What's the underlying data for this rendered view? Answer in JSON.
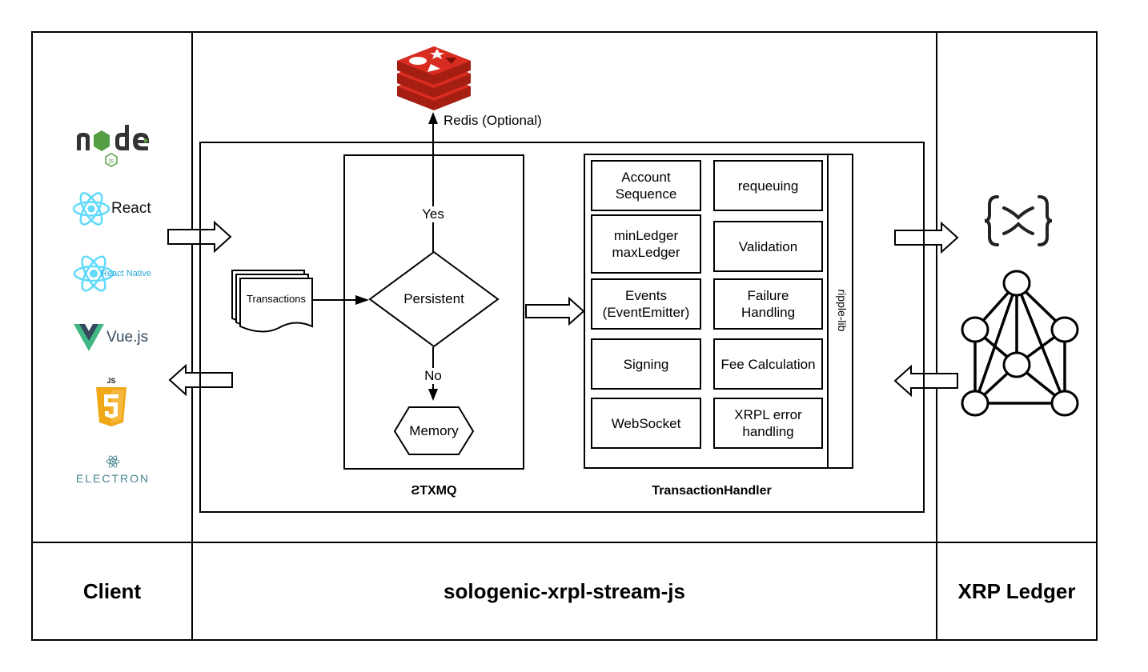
{
  "columns": {
    "client": "Client",
    "middle": "sologenic-xrpl-stream-js",
    "ledger": "XRP Ledger"
  },
  "client_logos": [
    {
      "name": "Node.js",
      "icon": "nodejs-logo",
      "text": "node",
      "sub": "JS"
    },
    {
      "name": "React",
      "icon": "react-logo",
      "text": "React"
    },
    {
      "name": "React Native",
      "icon": "react-native-logo",
      "text": "React Native"
    },
    {
      "name": "Vue.js",
      "icon": "vuejs-logo",
      "text": "Vue.js"
    },
    {
      "name": "JavaScript",
      "icon": "js-shield-logo",
      "text": "JS"
    },
    {
      "name": "Electron",
      "icon": "electron-logo",
      "text": "ELECTRON"
    }
  ],
  "redis": {
    "icon": "redis-logo",
    "label": "Redis (Optional)"
  },
  "stxmq": {
    "caption": "ƧTXMQ",
    "input": "Transactions",
    "decision": "Persistent",
    "yes_label": "Yes",
    "no_label": "No",
    "memory": "Memory"
  },
  "transaction_handler": {
    "caption": "TransactionHandler",
    "side_label": "ripple-lib",
    "left_items": [
      "Account\nSequence",
      "minLedger\nmaxLedger",
      "Events\n(EventEmitter)",
      "Signing",
      "WebSocket"
    ],
    "right_items": [
      "requeuing",
      "Validation",
      "Failure\nHandling",
      "Fee Calculation",
      "XRPL error\nhandling"
    ]
  },
  "ledger": {
    "xrp_icon": "xrp-logo",
    "network_icon": "network-graph-icon"
  },
  "colors": {
    "redis_red": "#d82c20",
    "redis_dark": "#a41e11",
    "react_blue": "#61dafb",
    "node_green": "#539e43",
    "node_dark": "#333333",
    "vue_green": "#41b883",
    "vue_dark": "#35495e",
    "js_yellow": "#f0a818",
    "electron_teal": "#47848f"
  }
}
